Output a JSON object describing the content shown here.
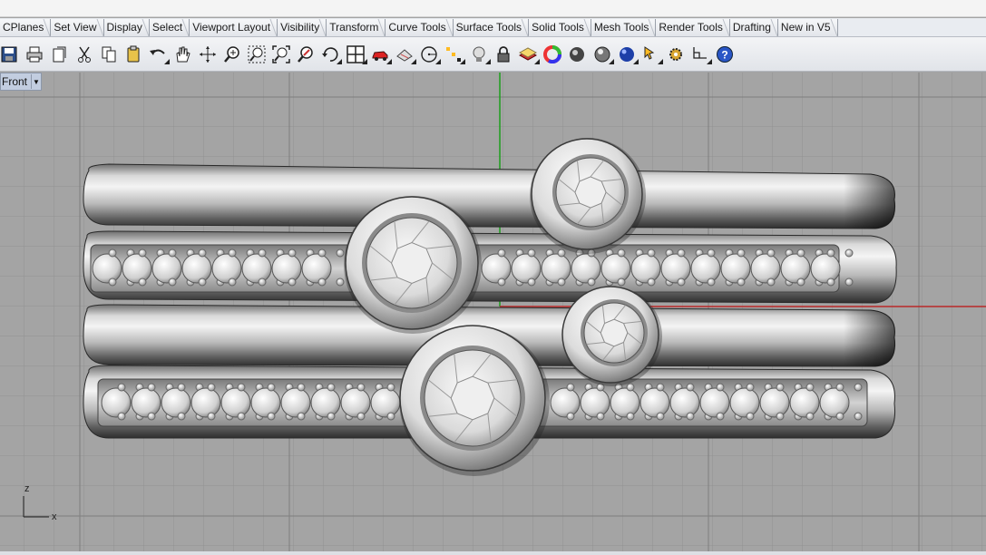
{
  "tabs": [
    {
      "label": "CPlanes"
    },
    {
      "label": "Set View"
    },
    {
      "label": "Display"
    },
    {
      "label": "Select"
    },
    {
      "label": "Viewport Layout"
    },
    {
      "label": "Visibility"
    },
    {
      "label": "Transform"
    },
    {
      "label": "Curve Tools"
    },
    {
      "label": "Surface Tools"
    },
    {
      "label": "Solid Tools"
    },
    {
      "label": "Mesh Tools"
    },
    {
      "label": "Render Tools"
    },
    {
      "label": "Drafting"
    },
    {
      "label": "New in V5"
    }
  ],
  "toolbar_icons": [
    "save-icon",
    "print-icon",
    "import-icon",
    "cut-icon",
    "copy-icon",
    "paste-icon",
    "undo-icon",
    "pan-icon",
    "rotate-view-icon",
    "zoom-icon",
    "zoom-window-icon",
    "zoom-extents-icon",
    "zoom-selected-icon",
    "rotate-icon",
    "four-viewports-icon",
    "car-icon",
    "shade-icon",
    "circle-icon",
    "point-icon",
    "light-icon",
    "lock-icon",
    "layer-icon",
    "color-wheel-icon",
    "render-sphere-icon",
    "material-sphere-icon",
    "blue-sphere-icon",
    "pointer-icon",
    "gear-icon",
    "dimension-icon",
    "help-icon"
  ],
  "viewport": {
    "name": "Front",
    "axis_z": "z",
    "axis_x": "x"
  }
}
